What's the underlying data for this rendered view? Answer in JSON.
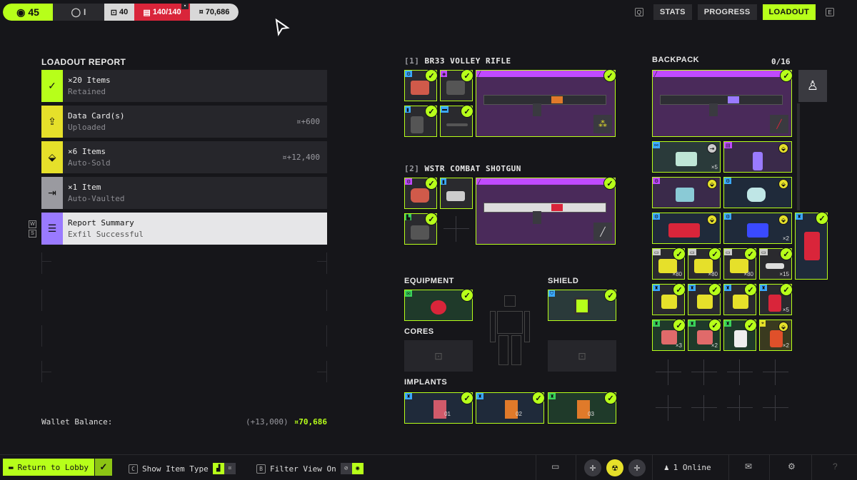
{
  "topbar": {
    "level": "45",
    "rank": "I",
    "keys": "40",
    "capacity": "140/140",
    "capacity_badge": "",
    "money": "70,686"
  },
  "nav": {
    "left_key": "Q",
    "right_key": "E",
    "tabs": [
      {
        "label": "STATS",
        "active": false
      },
      {
        "label": "PROGRESS",
        "active": false
      },
      {
        "label": "LOADOUT",
        "active": true
      }
    ]
  },
  "report": {
    "title": "LOADOUT REPORT",
    "rows": [
      {
        "main": "×20 Items",
        "sub": "Retained",
        "value": "",
        "icon": "check-icon",
        "color": "#b7ff1a"
      },
      {
        "main": "Data Card(s)",
        "sub": "Uploaded",
        "value": "+600",
        "icon": "upload-icon",
        "color": "#e6e02a"
      },
      {
        "main": "×6 Items",
        "sub": "Auto-Sold",
        "value": "+12,400",
        "icon": "sell-icon",
        "color": "#e6e02a"
      },
      {
        "main": "×1 Item",
        "sub": "Auto-Vaulted",
        "value": "",
        "icon": "vault-icon",
        "color": "#9a9aa0"
      },
      {
        "main": "Report Summary",
        "sub": "Exfil Successful",
        "value": "",
        "icon": "list-icon",
        "color": "#9a7aff"
      }
    ],
    "nav_keys": [
      "W",
      "S"
    ]
  },
  "wallet": {
    "label": "Wallet Balance:",
    "delta": "(+13,000)",
    "total": "70,686"
  },
  "weapons": [
    {
      "slot": "[1]",
      "name": "BR33 VOLLEY RIFLE"
    },
    {
      "slot": "[2]",
      "name": "WSTR COMBAT SHOTGUN"
    }
  ],
  "sections": {
    "equipment": "EQUIPMENT",
    "shield": "SHIELD",
    "cores": "CORES",
    "implants": "IMPLANTS"
  },
  "implant_codes": [
    "01",
    "02",
    "03"
  ],
  "backpack": {
    "title": "BACKPACK",
    "count": "0/16",
    "quantities": {
      "row1_a": "×5",
      "row3_b": "×2",
      "ammo1": "×80",
      "ammo2": "×80",
      "ammo3": "×80",
      "ammo4": "×15",
      "red1": "×5",
      "row6_a": "×3",
      "row6_b": "×2",
      "row6_d": "×2"
    }
  },
  "bottombar": {
    "return_label": "Return to Lobby",
    "show_item_key": "C",
    "show_item_label": "Show Item Type",
    "filter_key": "B",
    "filter_label": "Filter View On",
    "online": "1 Online",
    "help": "?"
  }
}
